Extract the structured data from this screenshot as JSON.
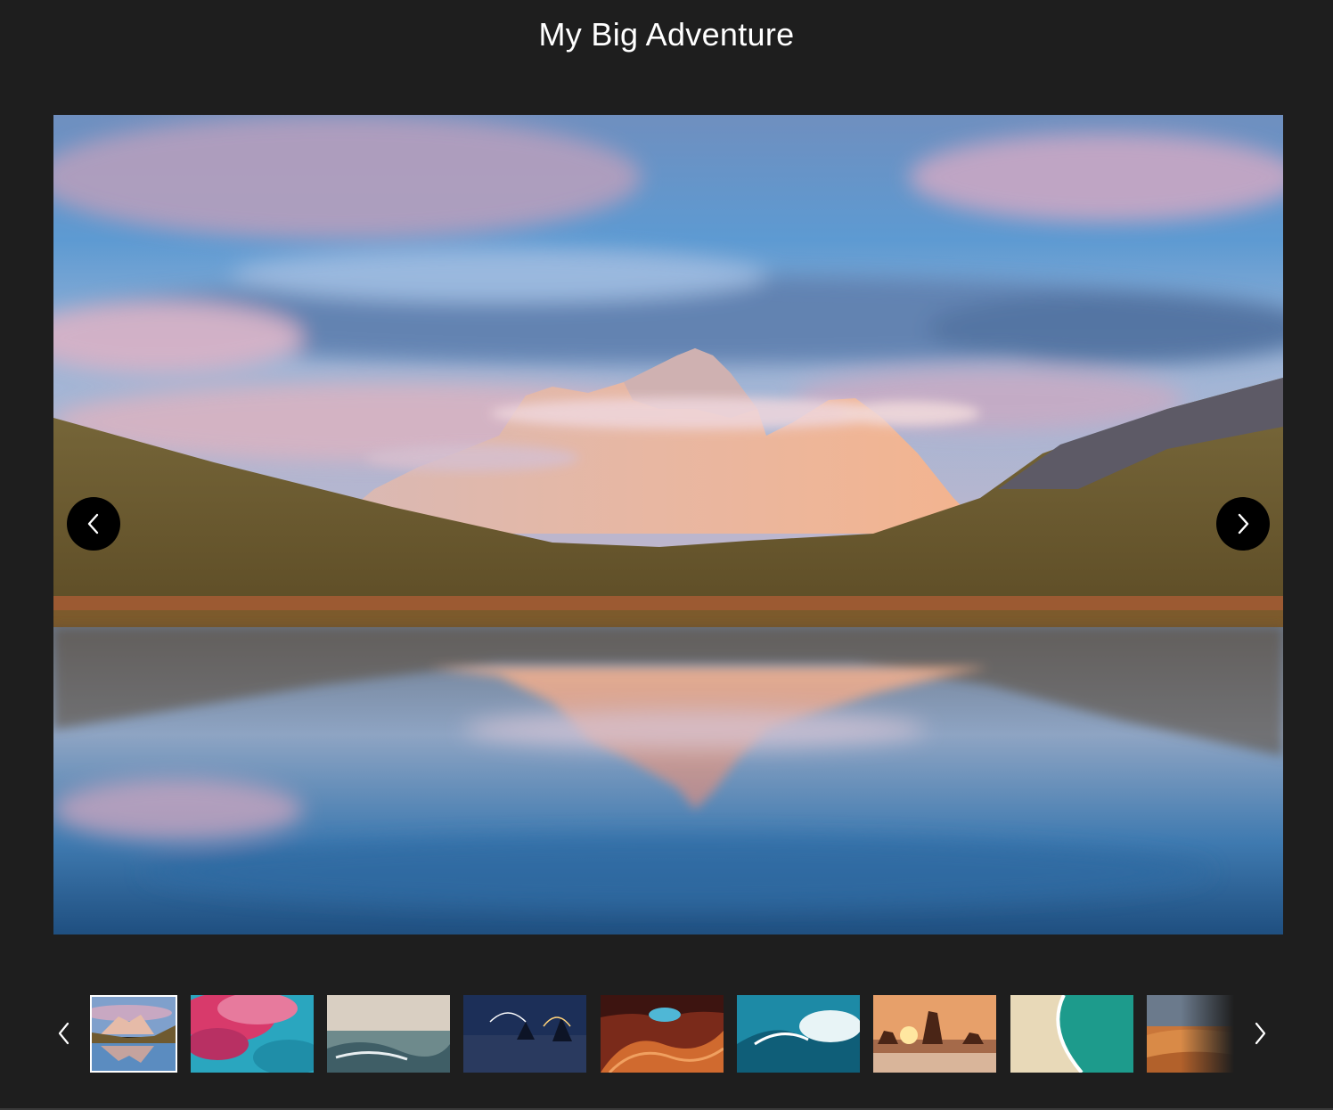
{
  "gallery": {
    "title": "My Big Adventure",
    "main_image": {
      "icon": "mountain-lake-reflection-image",
      "alt": "Mountain lake reflection at sunset"
    },
    "prev_button": {
      "icon": "chevron-left-icon"
    },
    "next_button": {
      "icon": "chevron-right-icon"
    },
    "thumbnails": [
      {
        "icon": "mountain-lake-thumbnail",
        "active": true
      },
      {
        "icon": "pink-clouds-thumbnail",
        "active": false
      },
      {
        "icon": "sea-waves-thumbnail",
        "active": false
      },
      {
        "icon": "night-beach-thumbnail",
        "active": false
      },
      {
        "icon": "canyon-thumbnail",
        "active": false
      },
      {
        "icon": "big-wave-thumbnail",
        "active": false
      },
      {
        "icon": "sunset-rocks-thumbnail",
        "active": false
      },
      {
        "icon": "beach-aerial-thumbnail",
        "active": false
      },
      {
        "icon": "desert-dunes-thumbnail",
        "active": false
      }
    ],
    "strip_prev": {
      "icon": "chevron-left-icon"
    },
    "strip_next": {
      "icon": "chevron-right-icon"
    },
    "colors": {
      "background": "#1e1e1e",
      "title_text": "#ffffff",
      "nav_button": "#000000",
      "active_thumb_border": "#ffffff"
    }
  }
}
